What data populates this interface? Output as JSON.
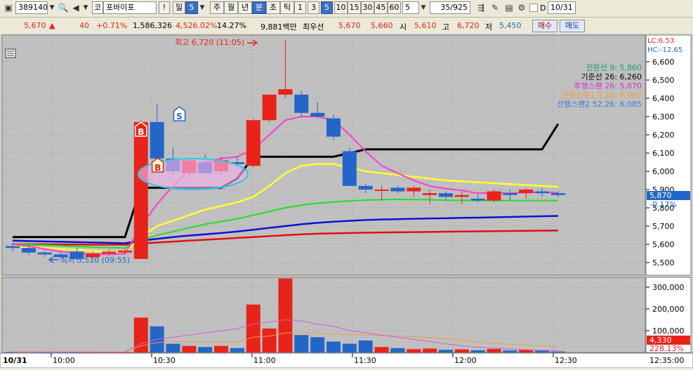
{
  "toolbar": {
    "code": "389140",
    "stock_prefix": "코",
    "stock_name": "포바이포",
    "alert_label": "!",
    "period_unit": "일",
    "period_value": "5",
    "periods": [
      "주",
      "월",
      "년",
      "분",
      "초",
      "틱"
    ],
    "intervals": [
      "1",
      "3",
      "5",
      "10",
      "15",
      "30",
      "45",
      "60"
    ],
    "interval_custom": "5",
    "count_display": "35/925",
    "date_value": "10/31",
    "checkbox_label": "D"
  },
  "quote": {
    "price": "5,670",
    "change_arrow": "▲",
    "change": "40",
    "change_pct": "+0.71%",
    "volume": "1,586,326",
    "volume_ratio": "4,526.02%",
    "turnover": "14.27%",
    "amount": "9,881백만",
    "best_label": "최우선",
    "best_ask": "5,670",
    "best_bid": "5,660",
    "open_label": "시",
    "open": "5,610",
    "high_label": "고",
    "high": "6,720",
    "low_label": "저",
    "low": "5,450",
    "buy_label": "매수",
    "sell_label": "매도"
  },
  "labels": {
    "lc": "LC:6.53",
    "hc": "HC:-12.65",
    "high_marker": "최고 6,720 (11:05)",
    "low_marker": "최저 5,510 (09:55)",
    "legend": [
      {
        "text": "전환선 9: 5,860",
        "color": "#1e9a73"
      },
      {
        "text": "기준선 26: 6,260",
        "color": "#000000"
      },
      {
        "text": "후행스팬 26: 5,870",
        "color": "#cc33cc"
      },
      {
        "text": "선행스팬1 9,26: 6,060",
        "color": "#e8a040"
      },
      {
        "text": "선행스팬2 52,26: 6,085",
        "color": "#3a7bd5"
      }
    ],
    "current_price_tag": "5,870",
    "current_pct_tag": "-0.17%",
    "volume_tag": "4,330",
    "volume_pct_tag": "228.13%",
    "date_label": "10/31",
    "end_time": "12:35:00",
    "signal_buy": "B",
    "signal_sell": "S"
  },
  "colors": {
    "up": "#e8231a",
    "down": "#2366c8",
    "bg": "#c0c0c0",
    "ma5": "#ff3ad0",
    "ma10": "#ffff33",
    "ma20": "#22e022",
    "ma60": "#1010d0",
    "ma120": "#e01010",
    "kijun": "#000000"
  },
  "chart_data": {
    "type": "candlestick",
    "y_ticks": [
      "6,600",
      "6,500",
      "6,400",
      "6,300",
      "6,200",
      "6,100",
      "6,000",
      "5,900",
      "5,800",
      "5,700",
      "5,600",
      "5,500"
    ],
    "ylim": [
      5450,
      6720
    ],
    "x_ticks": [
      "10:00",
      "10:30",
      "11:00",
      "11:30",
      "12:00",
      "12:30"
    ],
    "volume_ticks": [
      "300,000",
      "200,000",
      "100,000"
    ],
    "volume_ylim": [
      0,
      350000
    ],
    "candles": [
      {
        "o": 5590,
        "h": 5610,
        "l": 5560,
        "c": 5580
      },
      {
        "o": 5580,
        "h": 5595,
        "l": 5540,
        "c": 5555
      },
      {
        "o": 5555,
        "h": 5565,
        "l": 5530,
        "c": 5545
      },
      {
        "o": 5545,
        "h": 5555,
        "l": 5520,
        "c": 5530
      },
      {
        "o": 5560,
        "h": 5580,
        "l": 5510,
        "c": 5520
      },
      {
        "o": 5530,
        "h": 5560,
        "l": 5520,
        "c": 5550
      },
      {
        "o": 5550,
        "h": 5570,
        "l": 5540,
        "c": 5560
      },
      {
        "o": 5555,
        "h": 5575,
        "l": 5545,
        "c": 5565
      },
      {
        "o": 5520,
        "h": 6280,
        "l": 5520,
        "c": 6270
      },
      {
        "o": 6270,
        "h": 6370,
        "l": 6040,
        "c": 6070
      },
      {
        "o": 6070,
        "h": 6130,
        "l": 5980,
        "c": 6000
      },
      {
        "o": 5990,
        "h": 6060,
        "l": 5960,
        "c": 6060
      },
      {
        "o": 6050,
        "h": 6090,
        "l": 5990,
        "c": 5990
      },
      {
        "o": 6000,
        "h": 6080,
        "l": 5980,
        "c": 6060
      },
      {
        "o": 6050,
        "h": 6080,
        "l": 6010,
        "c": 6040
      },
      {
        "o": 6030,
        "h": 6290,
        "l": 6020,
        "c": 6280
      },
      {
        "o": 6280,
        "h": 6420,
        "l": 6270,
        "c": 6420
      },
      {
        "o": 6420,
        "h": 6720,
        "l": 6400,
        "c": 6450
      },
      {
        "o": 6420,
        "h": 6440,
        "l": 6300,
        "c": 6320
      },
      {
        "o": 6320,
        "h": 6380,
        "l": 6290,
        "c": 6300
      },
      {
        "o": 6290,
        "h": 6310,
        "l": 6170,
        "c": 6190
      },
      {
        "o": 6110,
        "h": 6130,
        "l": 5920,
        "c": 5920
      },
      {
        "o": 5920,
        "h": 5930,
        "l": 5880,
        "c": 5900
      },
      {
        "o": 5900,
        "h": 5920,
        "l": 5840,
        "c": 5900
      },
      {
        "o": 5910,
        "h": 5920,
        "l": 5880,
        "c": 5890
      },
      {
        "o": 5890,
        "h": 5920,
        "l": 5860,
        "c": 5910
      },
      {
        "o": 5870,
        "h": 5900,
        "l": 5820,
        "c": 5880
      },
      {
        "o": 5880,
        "h": 5890,
        "l": 5840,
        "c": 5860
      },
      {
        "o": 5860,
        "h": 5890,
        "l": 5820,
        "c": 5870
      },
      {
        "o": 5850,
        "h": 5870,
        "l": 5830,
        "c": 5840
      },
      {
        "o": 5840,
        "h": 5900,
        "l": 5830,
        "c": 5890
      },
      {
        "o": 5880,
        "h": 5900,
        "l": 5840,
        "c": 5870
      },
      {
        "o": 5880,
        "h": 5910,
        "l": 5850,
        "c": 5900
      },
      {
        "o": 5890,
        "h": 5910,
        "l": 5860,
        "c": 5880
      },
      {
        "o": 5880,
        "h": 5890,
        "l": 5860,
        "c": 5870
      }
    ],
    "volumes": [
      2000,
      3000,
      2000,
      2500,
      2000,
      2000,
      2000,
      1500,
      160000,
      120000,
      40000,
      30000,
      25000,
      30000,
      20000,
      220000,
      110000,
      340000,
      80000,
      70000,
      50000,
      40000,
      55000,
      25000,
      20000,
      15000,
      18000,
      12000,
      14000,
      10000,
      16000,
      9000,
      12000,
      8000,
      4330
    ],
    "ma5": [
      5600,
      5590,
      5575,
      5560,
      5550,
      5545,
      5545,
      5548,
      5700,
      5820,
      5920,
      6010,
      6050,
      6070,
      6080,
      6120,
      6200,
      6280,
      6300,
      6300,
      6280,
      6200,
      6110,
      6030,
      5990,
      5950,
      5920,
      5905,
      5895,
      5880,
      5882,
      5880,
      5885,
      5885,
      5882
    ],
    "ma10": [
      5590,
      5585,
      5580,
      5575,
      5570,
      5565,
      5560,
      5558,
      5640,
      5700,
      5730,
      5760,
      5790,
      5810,
      5830,
      5860,
      5920,
      5990,
      6030,
      6040,
      6040,
      6020,
      6000,
      5990,
      5980,
      5970,
      5960,
      5950,
      5945,
      5940,
      5935,
      5930,
      5925,
      5920,
      5915
    ],
    "ma20": [
      5600,
      5598,
      5595,
      5592,
      5588,
      5585,
      5582,
      5580,
      5620,
      5650,
      5670,
      5690,
      5710,
      5725,
      5740,
      5760,
      5780,
      5800,
      5815,
      5825,
      5832,
      5838,
      5842,
      5845,
      5846,
      5845,
      5844,
      5842,
      5841,
      5840,
      5840,
      5840,
      5840,
      5840,
      5840
    ],
    "ma60": [
      5620,
      5618,
      5616,
      5614,
      5612,
      5610,
      5608,
      5606,
      5620,
      5630,
      5640,
      5648,
      5655,
      5662,
      5670,
      5680,
      5690,
      5700,
      5710,
      5718,
      5724,
      5729,
      5733,
      5736,
      5738,
      5740,
      5742,
      5743,
      5745,
      5746,
      5748,
      5750,
      5752,
      5754,
      5756
    ],
    "ma120": [
      5600,
      5600,
      5600,
      5599,
      5599,
      5598,
      5598,
      5598,
      5605,
      5610,
      5615,
      5620,
      5625,
      5630,
      5635,
      5640,
      5645,
      5650,
      5655,
      5658,
      5660,
      5662,
      5664,
      5665,
      5666,
      5667,
      5668,
      5669,
      5670,
      5671,
      5672,
      5673,
      5674,
      5675,
      5676
    ],
    "kijun": [
      5640,
      5640,
      5640,
      5640,
      5640,
      5640,
      5640,
      5640,
      5910,
      5910,
      5910,
      5910,
      5910,
      5910,
      5960,
      6080,
      6080,
      6080,
      6080,
      6080,
      6080,
      6100,
      6120,
      6120,
      6120,
      6120,
      6120,
      6120,
      6120,
      6120,
      6120,
      6120,
      6120,
      6120,
      6260
    ],
    "vol_ma_orange": [
      1500,
      1800,
      2000,
      2000,
      2000,
      2000,
      1800,
      1800,
      30000,
      45000,
      50000,
      50000,
      48000,
      50000,
      48000,
      70000,
      75000,
      90000,
      90000,
      88000,
      85000,
      82000,
      80000,
      78000,
      75000,
      72000,
      68000,
      62000,
      55000,
      48000,
      42000,
      38000,
      34000,
      30000,
      26000
    ],
    "vol_ma_pink": [
      3000,
      3000,
      2500,
      2500,
      2000,
      2000,
      2000,
      2000,
      40000,
      60000,
      70000,
      80000,
      90000,
      100000,
      110000,
      130000,
      140000,
      150000,
      145000,
      130000,
      120000,
      100000,
      90000,
      80000,
      70000,
      60000,
      50000,
      40000,
      30000,
      25000,
      20000,
      15000,
      12000,
      10000,
      8000
    ]
  }
}
